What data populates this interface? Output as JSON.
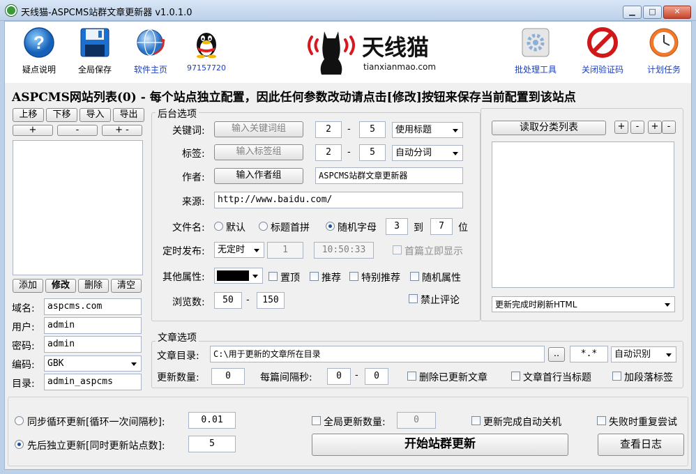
{
  "window": {
    "title": "天线猫-ASPCMS站群文章更新器 v1.0.1.0",
    "controls": {
      "minimize": "▁",
      "maximize": "□",
      "close": "✕"
    }
  },
  "toolbar": {
    "items": [
      {
        "label": "疑点说明",
        "icon": "help-icon"
      },
      {
        "label": "全局保存",
        "icon": "floppy-disk-icon"
      },
      {
        "label": "软件主页",
        "icon": "globe-icon"
      },
      {
        "label": "97157720",
        "icon": "qq-penguin-icon"
      }
    ],
    "logo": {
      "name": "天线猫",
      "url": "tianxianmao.com"
    },
    "right_items": [
      {
        "label": "批处理工具",
        "icon": "batch-tool-icon"
      },
      {
        "label": "关闭验证码",
        "icon": "no-sign-icon"
      },
      {
        "label": "计划任务",
        "icon": "clock-icon"
      }
    ]
  },
  "header": {
    "text": "ASPCMS网站列表(0) - 每个站点独立配置，因此任何参数改动请点击[修改]按钮来保存当前配置到该站点"
  },
  "site_list": {
    "top_buttons": [
      "上移",
      "下移",
      "导入",
      "导出"
    ],
    "small_buttons": [
      "+",
      "-",
      "+ -"
    ],
    "action_buttons": [
      "添加",
      "修改",
      "删除",
      "清空"
    ],
    "fields": [
      {
        "label": "域名:",
        "value": "aspcms.com"
      },
      {
        "label": "用户:",
        "value": "admin"
      },
      {
        "label": "密码:",
        "value": "admin"
      },
      {
        "label": "编码:",
        "value": "GBK"
      },
      {
        "label": "目录:",
        "value": "admin_aspcms"
      }
    ]
  },
  "backend": {
    "title": "后台选项",
    "keyword": {
      "label": "关键词:",
      "button": "输入关键词组",
      "min": "2",
      "max": "5",
      "mode": "使用标题"
    },
    "tag": {
      "label": "标签:",
      "button": "输入标签组",
      "min": "2",
      "max": "5",
      "mode": "自动分词"
    },
    "author": {
      "label": "作者:",
      "button": "输入作者组",
      "value": "ASPCMS站群文章更新器"
    },
    "source": {
      "label": "来源:",
      "value": "http://www.baidu.com/"
    },
    "filename": {
      "label": "文件名:",
      "options": [
        "默认",
        "标题首拼",
        "随机字母"
      ],
      "selected": 2,
      "from": "3",
      "to_label": "到",
      "to": "7",
      "unit": "位"
    },
    "schedule": {
      "label": "定时发布:",
      "mode": "无定时",
      "count": "1",
      "time": "10:50:33",
      "first_show": "首篇立即显示"
    },
    "other": {
      "label": "其他属性:",
      "color": "#000000",
      "checks": [
        "置顶",
        "推荐",
        "特别推荐",
        "随机属性"
      ]
    },
    "views": {
      "label": "浏览数:",
      "min": "50",
      "max": "150",
      "no_comment": "禁止评论"
    },
    "dash": "-"
  },
  "category": {
    "read_button": "读取分类列表",
    "small_buttons": [
      "+",
      "-",
      "+",
      "-"
    ],
    "refresh_mode": "更新完成时刷新HTML"
  },
  "article": {
    "title": "文章选项",
    "dir_label": "文章目录:",
    "dir_value": "C:\\用于更新的文章所在目录",
    "browse": "..",
    "ext": "*.*",
    "encoding": "自动识别",
    "count_label": "更新数量:",
    "count": "0",
    "interval_label": "每篇间隔秒:",
    "interval_min": "0",
    "interval_max": "0",
    "checks": [
      "删除已更新文章",
      "文章首行当标题",
      "加段落标签"
    ]
  },
  "bottom": {
    "sync_label": "同步循环更新[循环一次间隔秒]:",
    "sync_value": "0.01",
    "seq_label": "先后独立更新[同时更新站点数]:",
    "seq_value": "5",
    "global_count_label": "全局更新数量:",
    "global_count": "0",
    "auto_shutdown": "更新完成自动关机",
    "retry": "失败时重复尝试",
    "start": "开始站群更新",
    "log": "查看日志"
  }
}
